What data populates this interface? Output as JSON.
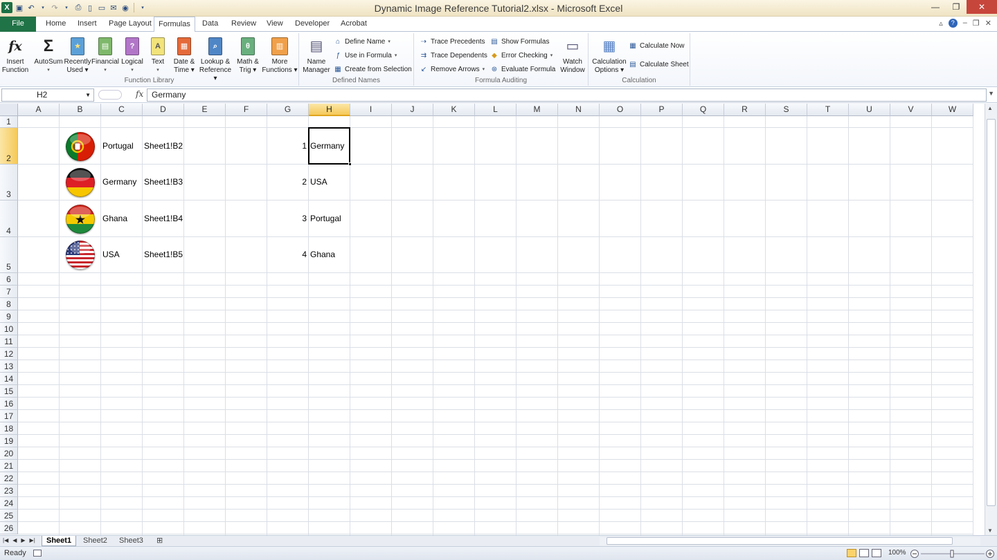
{
  "window": {
    "title": "Dynamic Image Reference Tutorial2.xlsx - Microsoft Excel",
    "minimize": "—",
    "restore": "❐",
    "close": "✕"
  },
  "ribbon_tabs": [
    "File",
    "Home",
    "Insert",
    "Page Layout",
    "Formulas",
    "Data",
    "Review",
    "View",
    "Developer",
    "Acrobat"
  ],
  "active_tab": "Formulas",
  "ribbon": {
    "function_library": {
      "label": "Function Library",
      "buttons": [
        {
          "label1": "Insert",
          "label2": "Function",
          "icon": "fx-icon"
        },
        {
          "label1": "AutoSum",
          "label2": "▾",
          "icon": "sigma-icon"
        },
        {
          "label1": "Recently",
          "label2": "Used ▾",
          "icon": "recent-book-icon"
        },
        {
          "label1": "Financial",
          "label2": "▾",
          "icon": "financial-book-icon"
        },
        {
          "label1": "Logical",
          "label2": "▾",
          "icon": "logical-book-icon"
        },
        {
          "label1": "Text",
          "label2": "▾",
          "icon": "text-book-icon"
        },
        {
          "label1": "Date &",
          "label2": "Time ▾",
          "icon": "date-book-icon"
        },
        {
          "label1": "Lookup &",
          "label2": "Reference ▾",
          "icon": "lookup-book-icon"
        },
        {
          "label1": "Math &",
          "label2": "Trig ▾",
          "icon": "math-book-icon"
        },
        {
          "label1": "More",
          "label2": "Functions ▾",
          "icon": "more-books-icon"
        }
      ]
    },
    "defined_names": {
      "label": "Defined Names",
      "name_manager": {
        "label1": "Name",
        "label2": "Manager"
      },
      "define_name": "Define Name",
      "use_in_formula": "Use in Formula",
      "create_from_selection": "Create from Selection"
    },
    "formula_auditing": {
      "label": "Formula Auditing",
      "trace_precedents": "Trace Precedents",
      "trace_dependents": "Trace Dependents",
      "remove_arrows": "Remove Arrows",
      "show_formulas": "Show Formulas",
      "error_checking": "Error Checking",
      "evaluate_formula": "Evaluate Formula",
      "watch_window": {
        "label1": "Watch",
        "label2": "Window"
      }
    },
    "calculation": {
      "label": "Calculation",
      "options": {
        "label1": "Calculation",
        "label2": "Options ▾"
      },
      "calculate_now": "Calculate Now",
      "calculate_sheet": "Calculate Sheet"
    }
  },
  "formula_bar": {
    "name_box": "H2",
    "fx": "fx",
    "value": "Germany"
  },
  "grid": {
    "columns": [
      "A",
      "B",
      "C",
      "D",
      "E",
      "F",
      "G",
      "H",
      "I",
      "J",
      "K",
      "L",
      "M",
      "N",
      "O",
      "P",
      "Q",
      "R",
      "S",
      "T",
      "U",
      "V",
      "W"
    ],
    "rows": [
      "1",
      "2",
      "3",
      "4",
      "5",
      "6",
      "7",
      "8",
      "9",
      "10",
      "11",
      "12",
      "13",
      "14",
      "15",
      "16",
      "17",
      "18",
      "19",
      "20",
      "21",
      "22",
      "23",
      "24",
      "25",
      "26"
    ],
    "selected_cell": "H2",
    "data_rows": [
      {
        "flag": "portugal-flag-icon",
        "country": "Portugal",
        "ref": "Sheet1!B2",
        "index": "1",
        "lookup": "Germany"
      },
      {
        "flag": "germany-flag-icon",
        "country": "Germany",
        "ref": "Sheet1!B3",
        "index": "2",
        "lookup": "USA"
      },
      {
        "flag": "ghana-flag-icon",
        "country": "Ghana",
        "ref": "Sheet1!B4",
        "index": "3",
        "lookup": "Portugal"
      },
      {
        "flag": "usa-flag-icon",
        "country": "USA",
        "ref": "Sheet1!B5",
        "index": "4",
        "lookup": "Ghana"
      }
    ]
  },
  "sheet_tabs": [
    "Sheet1",
    "Sheet2",
    "Sheet3"
  ],
  "active_sheet": "Sheet1",
  "status": {
    "ready": "Ready",
    "zoom": "100%"
  },
  "colors": {
    "excel_green": "#207346",
    "selection_header": "#f5c95a",
    "gridline": "#dadfe6"
  }
}
